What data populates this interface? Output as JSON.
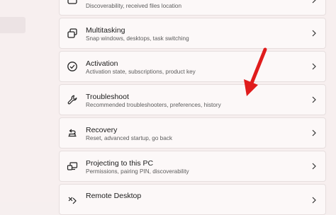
{
  "settings_list": [
    {
      "title": "",
      "subtitle": "Discoverability, received files location",
      "icon": "devices-icon"
    },
    {
      "title": "Multitasking",
      "subtitle": "Snap windows, desktops, task switching",
      "icon": "multitasking-icon"
    },
    {
      "title": "Activation",
      "subtitle": "Activation state, subscriptions, product key",
      "icon": "activation-check-icon"
    },
    {
      "title": "Troubleshoot",
      "subtitle": "Recommended troubleshooters, preferences, history",
      "icon": "wrench-icon"
    },
    {
      "title": "Recovery",
      "subtitle": "Reset, advanced startup, go back",
      "icon": "recovery-icon"
    },
    {
      "title": "Projecting to this PC",
      "subtitle": "Permissions, pairing PIN, discoverability",
      "icon": "projecting-icon"
    },
    {
      "title": "Remote Desktop",
      "subtitle": "",
      "icon": "remote-desktop-icon"
    }
  ],
  "colors": {
    "background": "#f7efef",
    "card": "#fcf8f8",
    "card_border": "#e6dede",
    "annotation_arrow": "#e01c1c"
  }
}
